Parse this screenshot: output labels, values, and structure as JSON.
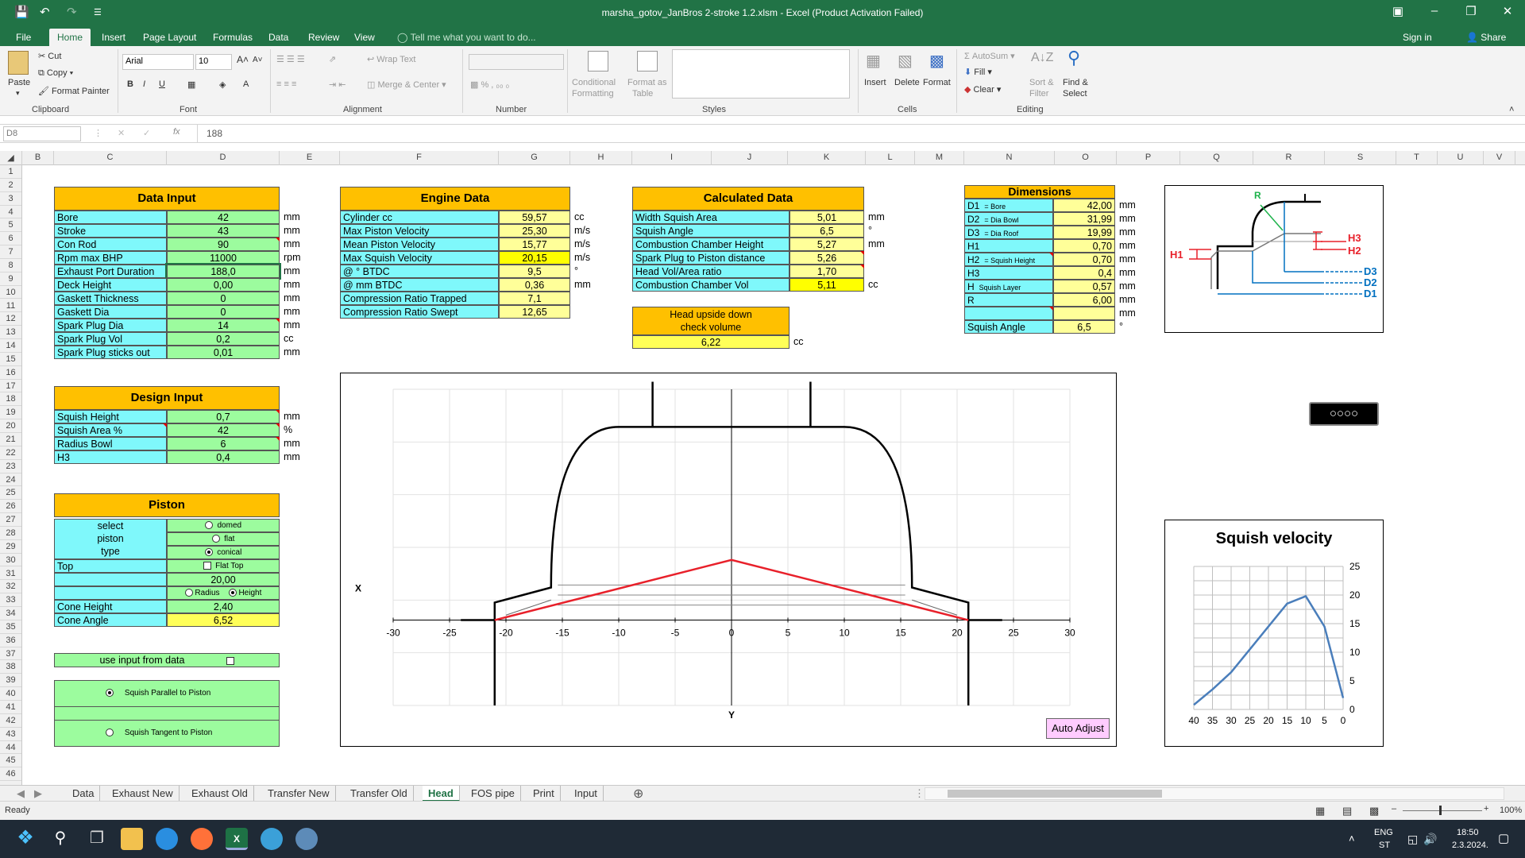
{
  "window": {
    "title": "marsha_gotov_JanBros 2-stroke 1.2.xlsm  -  Excel (Product Activation Failed)"
  },
  "ribbon_tabs": [
    "File",
    "Home",
    "Insert",
    "Page Layout",
    "Formulas",
    "Data",
    "Review",
    "View"
  ],
  "tell_me": "Tell me what you want to do...",
  "account": {
    "sign_in": "Sign in",
    "share": "Share"
  },
  "ribbon": {
    "clipboard": {
      "paste": "Paste",
      "cut": "Cut",
      "copy": "Copy",
      "format_painter": "Format Painter",
      "label": "Clipboard"
    },
    "font": {
      "name": "Arial",
      "size": "10",
      "label": "Font"
    },
    "alignment": {
      "wrap": "Wrap Text",
      "merge": "Merge & Center",
      "label": "Alignment"
    },
    "number": {
      "label": "Number"
    },
    "styles": {
      "cond": "Conditional",
      "cond2": "Formatting",
      "fmt": "Format as",
      "fmt2": "Table",
      "label": "Styles"
    },
    "cells": {
      "insert": "Insert",
      "delete": "Delete",
      "format": "Format",
      "label": "Cells"
    },
    "editing": {
      "autosum": "AutoSum",
      "fill": "Fill",
      "clear": "Clear",
      "sort": "Sort &",
      "sort2": "Filter",
      "find": "Find &",
      "find2": "Select",
      "label": "Editing"
    }
  },
  "formula_bar": {
    "name_box": "D8",
    "fx": "fx",
    "value": "188"
  },
  "columns": [
    "B",
    "C",
    "D",
    "E",
    "F",
    "G",
    "H",
    "I",
    "J",
    "K",
    "L",
    "M",
    "N",
    "O",
    "P",
    "Q",
    "R",
    "S",
    "T",
    "U",
    "V"
  ],
  "data_input": {
    "title": "Data Input",
    "rows": [
      {
        "label": "Bore",
        "value": "42",
        "unit": "mm"
      },
      {
        "label": "Stroke",
        "value": "43",
        "unit": "mm"
      },
      {
        "label": "Con   Rod",
        "value": "90",
        "unit": "mm"
      },
      {
        "label": "Rpm max BHP",
        "value": "11000",
        "unit": "rpm"
      },
      {
        "label": "Exhaust Port Duration",
        "value": "188,0",
        "unit": "mm"
      },
      {
        "label": "Deck   Height",
        "value": "0,00",
        "unit": "mm"
      },
      {
        "label": "Gaskett   Thickness",
        "value": "0",
        "unit": "mm"
      },
      {
        "label": "Gaskett   Dia",
        "value": "0",
        "unit": "mm"
      },
      {
        "label": "Spark   Plug   Dia",
        "value": "14",
        "unit": "mm"
      },
      {
        "label": "Spark   Plug   Vol",
        "value": "0,2",
        "unit": "cc"
      },
      {
        "label": "Spark Plug sticks out",
        "value": "0,01",
        "unit": "mm"
      }
    ]
  },
  "design_input": {
    "title": "Design Input",
    "rows": [
      {
        "label": "Squish   Height",
        "value": "0,7",
        "unit": "mm"
      },
      {
        "label": "Squish   Area    %",
        "value": "42",
        "unit": "%"
      },
      {
        "label": "Radius   Bowl",
        "value": "6",
        "unit": "mm"
      },
      {
        "label": "H3",
        "value": "0,4",
        "unit": "mm"
      }
    ]
  },
  "piston": {
    "title": "Piston",
    "select": "select",
    "piston": "piston",
    "type": "type",
    "opt_domed": "domed",
    "opt_flat": "flat",
    "opt_conical": "conical",
    "top_label": "Top",
    "flat_top": "Flat Top",
    "value_31": "20,00",
    "radius": "Radius",
    "height": "Height",
    "cone_height_label": "Cone Height",
    "cone_height": "2,40",
    "cone_angle_label": "Cone Angle",
    "cone_angle": "6,52"
  },
  "options": {
    "use_input": "use input from data",
    "parallel": "Squish Parallel to Piston",
    "tangent": "Squish Tangent to Piston"
  },
  "engine_data": {
    "title": "Engine Data",
    "rows": [
      {
        "label": "Cylinder   cc",
        "value": "59,57",
        "unit": "cc"
      },
      {
        "label": "Max   Piston   Velocity",
        "value": "25,30",
        "unit": "m/s"
      },
      {
        "label": "Mean   Piston   Velocity",
        "value": "15,77",
        "unit": "m/s"
      },
      {
        "label": "Max  Squish Velocity",
        "value": "20,15",
        "unit": "m/s"
      },
      {
        "label": "@        °      BTDC",
        "value": "9,5",
        "unit": "°"
      },
      {
        "label": "@       mm BTDC",
        "value": "0,36",
        "unit": "mm"
      },
      {
        "label": "Compression   Ratio   Trapped",
        "value": "7,1",
        "unit": ""
      },
      {
        "label": "Compression   Ratio   Swept",
        "value": "12,65",
        "unit": ""
      }
    ]
  },
  "calculated_data": {
    "title": "Calculated Data",
    "rows": [
      {
        "label": "Width   Squish   Area",
        "value": "5,01",
        "unit": "mm"
      },
      {
        "label": "Squish   Angle",
        "value": "6,5",
        "unit": "°"
      },
      {
        "label": "Combustion   Chamber   Height",
        "value": "5,27",
        "unit": "mm"
      },
      {
        "label": "Spark Plug to Piston distance",
        "value": "5,26",
        "unit": ""
      },
      {
        "label": "Head   Vol/Area   ratio",
        "value": "1,70",
        "unit": ""
      },
      {
        "label": "Combustion   Chamber   Vol",
        "value": "5,11",
        "unit": "cc"
      }
    ],
    "head_check_1": "Head upside down",
    "head_check_2": "check volume",
    "head_check_value": "6,22",
    "head_check_unit": "cc"
  },
  "dimensions": {
    "title": "Dimensions",
    "rows": [
      {
        "key": "D1",
        "note": "= Bore",
        "value": "42,00",
        "unit": "mm"
      },
      {
        "key": "D2",
        "note": "= Dia Bowl",
        "value": "31,99",
        "unit": "mm"
      },
      {
        "key": "D3",
        "note": "= Dia Roof",
        "value": "19,99",
        "unit": "mm"
      },
      {
        "key": "H1",
        "note": "",
        "value": "0,70",
        "unit": "mm"
      },
      {
        "key": "H2",
        "note": "= Squish Height",
        "value": "0,70",
        "unit": "mm"
      },
      {
        "key": "H3",
        "note": "",
        "value": "0,4",
        "unit": "mm"
      },
      {
        "key": "H",
        "note": "Squish Layer",
        "value": "0,57",
        "unit": "mm"
      },
      {
        "key": "R",
        "note": "",
        "value": "6,00",
        "unit": "mm"
      },
      {
        "key": "",
        "note": "",
        "value": "",
        "unit": "mm"
      }
    ],
    "angle_label": "Squish Angle",
    "angle_value": "6,5",
    "angle_unit": "°"
  },
  "diagram_labels": {
    "R": "R",
    "H1": "H1",
    "H2": "H2",
    "H3": "H3",
    "D1": "D1",
    "D2": "D2",
    "D3": "D3"
  },
  "profile_chart": {
    "x_ticks": [
      "-30",
      "-25",
      "-20",
      "-15",
      "-10",
      "-5",
      "0",
      "5",
      "10",
      "15",
      "20",
      "25",
      "30"
    ],
    "x_label": "X",
    "y_label": "Y",
    "button": "Auto Adjust"
  },
  "chart_data": {
    "type": "line",
    "title": "Squish velocity",
    "xlabel": "",
    "ylabel": "",
    "x": [
      40,
      35,
      30,
      25,
      20,
      15,
      10,
      5,
      0
    ],
    "series": [
      {
        "values": [
          0.8,
          3.5,
          6.5,
          10.5,
          14.5,
          18.5,
          19.8,
          14.5,
          2.0
        ]
      }
    ],
    "xlim": [
      40,
      0
    ],
    "ylim": [
      0,
      25
    ],
    "x_ticks": [
      "40",
      "35",
      "30",
      "25",
      "20",
      "15",
      "10",
      "5",
      "0"
    ],
    "y_ticks": [
      "25",
      "20",
      "15",
      "10",
      "5",
      "0"
    ],
    "grid": true,
    "line_color": "#4a7ebb"
  },
  "sheet_tabs": [
    "Data",
    "Exhaust New",
    "Exhaust Old",
    "Transfer New",
    "Transfer Old",
    "Head",
    "FOS pipe",
    "Print",
    "Input"
  ],
  "active_sheet": "Head",
  "status": {
    "ready": "Ready",
    "zoom": "100%"
  },
  "taskbar": {
    "lang1": "ENG",
    "lang2": "ST",
    "time": "18:50",
    "date": "2.3.2024."
  },
  "colors": {
    "excel_green": "#217346",
    "header": "#ffc000",
    "cyan": "#7ff8fb",
    "green": "#9cfc9e",
    "yellow": "#ffff58"
  }
}
